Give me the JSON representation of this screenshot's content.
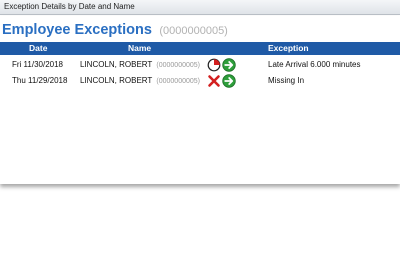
{
  "window": {
    "title": "Exception Details by Date and Name"
  },
  "header": {
    "title": "Employee Exceptions",
    "employee_id": "(0000000005)"
  },
  "table": {
    "columns": {
      "date": "Date",
      "name": "Name",
      "exception": "Exception"
    },
    "rows": [
      {
        "date": "Fri 11/30/2018",
        "name": "LINCOLN, ROBERT",
        "emp_id": "(0000000005)",
        "status_icon": "clock-icon",
        "action_icon": "go-arrow-icon",
        "exception": "Late Arrival 6.000  minutes"
      },
      {
        "date": "Thu 11/29/2018",
        "name": "LINCOLN, ROBERT",
        "emp_id": "(0000000005)",
        "status_icon": "red-x-icon",
        "action_icon": "go-arrow-icon",
        "exception": "Missing In"
      }
    ]
  },
  "colors": {
    "heading": "#2a6fc2",
    "header_bar": "#1f5aa6",
    "go_arrow": "#2e9e3b",
    "missing": "#d32020",
    "clock": "#d32020"
  }
}
